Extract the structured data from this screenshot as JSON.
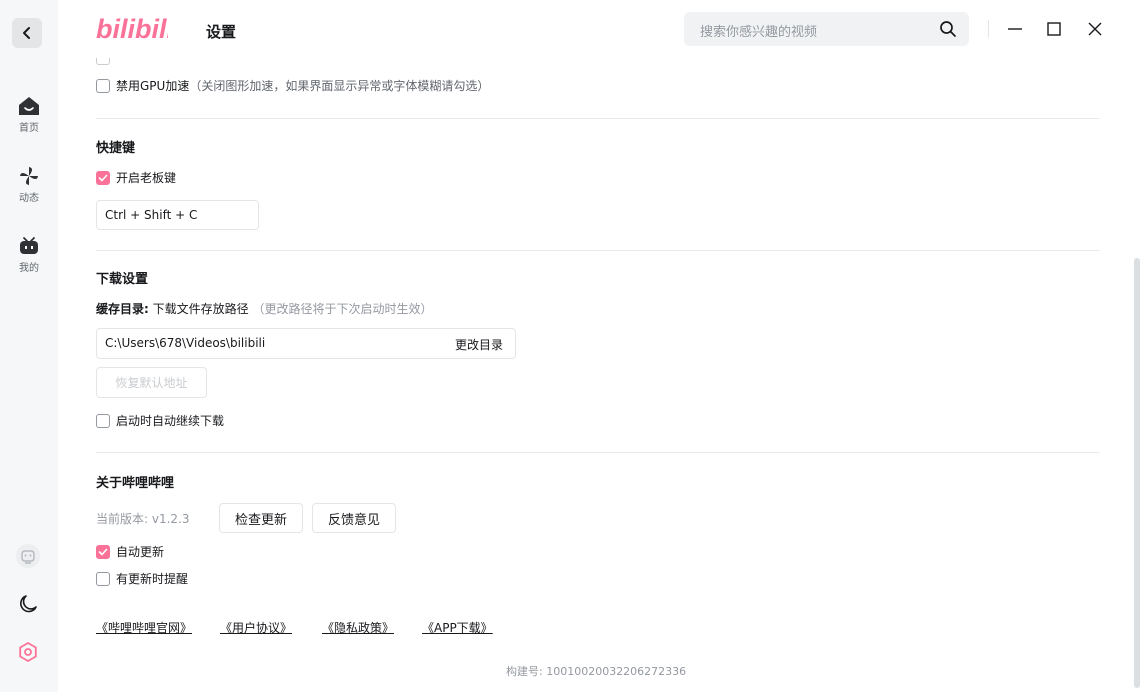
{
  "header": {
    "logo_alt": "bilibili",
    "title": "设置",
    "search_placeholder": "搜索你感兴趣的视频"
  },
  "nav": {
    "items": [
      {
        "label": "首页"
      },
      {
        "label": "动态"
      },
      {
        "label": "我的"
      }
    ]
  },
  "display": {
    "gpu_label": "禁用GPU加速",
    "gpu_note": "（关闭图形加速，如果界面显示异常或字体模糊请勾选）",
    "gpu_checked": false
  },
  "shortcuts": {
    "title": "快捷键",
    "boss_key_label": "开启老板键",
    "boss_key_checked": true,
    "boss_key_value": "Ctrl + Shift + C"
  },
  "download": {
    "title": "下载设置",
    "cache_label": "缓存目录:",
    "cache_desc": "下载文件存放路径",
    "cache_note": "（更改路径将于下次启动时生效）",
    "path": "C:\\Users\\678\\Videos\\bilibili",
    "change_dir": "更改目录",
    "restore_default": "恢复默认地址",
    "auto_resume_label": "启动时自动继续下载",
    "auto_resume_checked": false
  },
  "about": {
    "title": "关于哔哩哔哩",
    "version_text": "当前版本: v1.2.3",
    "check_update": "检查更新",
    "feedback": "反馈意见",
    "auto_update_label": "自动更新",
    "auto_update_checked": true,
    "notify_label": "有更新时提醒",
    "notify_checked": false,
    "links": [
      "《哔哩哔哩官网》",
      "《用户协议》",
      "《隐私政策》",
      "《APP下载》"
    ],
    "build": "构建号: 10010020032206272336"
  },
  "colors": {
    "brand": "#fb7299",
    "text": "#18191c",
    "muted": "#9499a0"
  }
}
